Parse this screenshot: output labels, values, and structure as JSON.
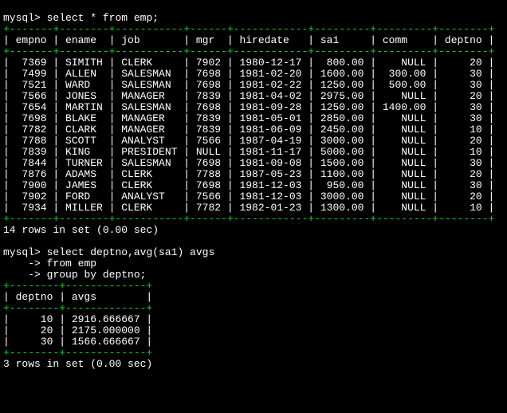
{
  "prompt": "mysql>",
  "queries": {
    "q1": "select * from emp;",
    "q2_line1": "select deptno,avg(sa1) avgs",
    "q2_line2": "from emp",
    "q2_line3": "group by deptno;",
    "cont": "->"
  },
  "table1": {
    "sep": "+-------+--------+-----------+------+------------+---------+---------+--------+",
    "hdrrow": "| empno | ename  | job       | mgr  | hiredate   | sa1     | comm    | deptno |",
    "headers": [
      "empno",
      "ename",
      "job",
      "mgr",
      "hiredate",
      "sa1",
      "comm",
      "deptno"
    ],
    "rows": [
      {
        "empno": "7369",
        "ename": "SIMITH",
        "job": "CLERK",
        "mgr": "7902",
        "hiredate": "1980-12-17",
        "sa1": "800.00",
        "comm": "NULL",
        "deptno": "20"
      },
      {
        "empno": "7499",
        "ename": "ALLEN",
        "job": "SALESMAN",
        "mgr": "7698",
        "hiredate": "1981-02-20",
        "sa1": "1600.00",
        "comm": "300.00",
        "deptno": "30"
      },
      {
        "empno": "7521",
        "ename": "WARD",
        "job": "SALESMAN",
        "mgr": "7698",
        "hiredate": "1981-02-22",
        "sa1": "1250.00",
        "comm": "500.00",
        "deptno": "30"
      },
      {
        "empno": "7566",
        "ename": "JONES",
        "job": "MANAGER",
        "mgr": "7839",
        "hiredate": "1981-04-02",
        "sa1": "2975.00",
        "comm": "NULL",
        "deptno": "20"
      },
      {
        "empno": "7654",
        "ename": "MARTIN",
        "job": "SALESMAN",
        "mgr": "7698",
        "hiredate": "1981-09-28",
        "sa1": "1250.00",
        "comm": "1400.00",
        "deptno": "30"
      },
      {
        "empno": "7698",
        "ename": "BLAKE",
        "job": "MANAGER",
        "mgr": "7839",
        "hiredate": "1981-05-01",
        "sa1": "2850.00",
        "comm": "NULL",
        "deptno": "30"
      },
      {
        "empno": "7782",
        "ename": "CLARK",
        "job": "MANAGER",
        "mgr": "7839",
        "hiredate": "1981-06-09",
        "sa1": "2450.00",
        "comm": "NULL",
        "deptno": "10"
      },
      {
        "empno": "7788",
        "ename": "SCOTT",
        "job": "ANALYST",
        "mgr": "7566",
        "hiredate": "1987-04-19",
        "sa1": "3000.00",
        "comm": "NULL",
        "deptno": "20"
      },
      {
        "empno": "7839",
        "ename": "KING",
        "job": "PRESIDENT",
        "mgr": "NULL",
        "hiredate": "1981-11-17",
        "sa1": "5000.00",
        "comm": "NULL",
        "deptno": "10"
      },
      {
        "empno": "7844",
        "ename": "TURNER",
        "job": "SALESMAN",
        "mgr": "7698",
        "hiredate": "1981-09-08",
        "sa1": "1500.00",
        "comm": "NULL",
        "deptno": "30"
      },
      {
        "empno": "7876",
        "ename": "ADAMS",
        "job": "CLERK",
        "mgr": "7788",
        "hiredate": "1987-05-23",
        "sa1": "1100.00",
        "comm": "NULL",
        "deptno": "20"
      },
      {
        "empno": "7900",
        "ename": "JAMES",
        "job": "CLERK",
        "mgr": "7698",
        "hiredate": "1981-12-03",
        "sa1": "950.00",
        "comm": "NULL",
        "deptno": "30"
      },
      {
        "empno": "7902",
        "ename": "FORD",
        "job": "ANALYST",
        "mgr": "7566",
        "hiredate": "1981-12-03",
        "sa1": "3000.00",
        "comm": "NULL",
        "deptno": "20"
      },
      {
        "empno": "7934",
        "ename": "MILLER",
        "job": "CLERK",
        "mgr": "7782",
        "hiredate": "1982-01-23",
        "sa1": "1300.00",
        "comm": "NULL",
        "deptno": "10"
      }
    ],
    "footer": "14 rows in set (0.00 sec)"
  },
  "table2": {
    "sep": "+--------+-------------+",
    "hdrrow": "| deptno | avgs        |",
    "headers": [
      "deptno",
      "avgs"
    ],
    "rows": [
      {
        "deptno": "10",
        "avgs": "2916.666667"
      },
      {
        "deptno": "20",
        "avgs": "2175.000000"
      },
      {
        "deptno": "30",
        "avgs": "1566.666667"
      }
    ],
    "footer": "3 rows in set (0.00 sec)"
  },
  "chart_data": [
    {
      "type": "table",
      "title": "emp",
      "columns": [
        "empno",
        "ename",
        "job",
        "mgr",
        "hiredate",
        "sa1",
        "comm",
        "deptno"
      ],
      "rows": [
        [
          7369,
          "SIMITH",
          "CLERK",
          7902,
          "1980-12-17",
          800.0,
          null,
          20
        ],
        [
          7499,
          "ALLEN",
          "SALESMAN",
          7698,
          "1981-02-20",
          1600.0,
          300.0,
          30
        ],
        [
          7521,
          "WARD",
          "SALESMAN",
          7698,
          "1981-02-22",
          1250.0,
          500.0,
          30
        ],
        [
          7566,
          "JONES",
          "MANAGER",
          7839,
          "1981-04-02",
          2975.0,
          null,
          20
        ],
        [
          7654,
          "MARTIN",
          "SALESMAN",
          7698,
          "1981-09-28",
          1250.0,
          1400.0,
          30
        ],
        [
          7698,
          "BLAKE",
          "MANAGER",
          7839,
          "1981-05-01",
          2850.0,
          null,
          30
        ],
        [
          7782,
          "CLARK",
          "MANAGER",
          7839,
          "1981-06-09",
          2450.0,
          null,
          10
        ],
        [
          7788,
          "SCOTT",
          "ANALYST",
          7566,
          "1987-04-19",
          3000.0,
          null,
          20
        ],
        [
          7839,
          "KING",
          "PRESIDENT",
          null,
          "1981-11-17",
          5000.0,
          null,
          10
        ],
        [
          7844,
          "TURNER",
          "SALESMAN",
          7698,
          "1981-09-08",
          1500.0,
          null,
          30
        ],
        [
          7876,
          "ADAMS",
          "CLERK",
          7788,
          "1987-05-23",
          1100.0,
          null,
          20
        ],
        [
          7900,
          "JAMES",
          "CLERK",
          7698,
          "1981-12-03",
          950.0,
          null,
          30
        ],
        [
          7902,
          "FORD",
          "ANALYST",
          7566,
          "1981-12-03",
          3000.0,
          null,
          20
        ],
        [
          7934,
          "MILLER",
          "CLERK",
          7782,
          "1982-01-23",
          1300.0,
          null,
          10
        ]
      ]
    },
    {
      "type": "table",
      "title": "avg(sa1) by deptno",
      "columns": [
        "deptno",
        "avgs"
      ],
      "rows": [
        [
          10,
          2916.666667
        ],
        [
          20,
          2175.0
        ],
        [
          30,
          1566.666667
        ]
      ]
    }
  ]
}
